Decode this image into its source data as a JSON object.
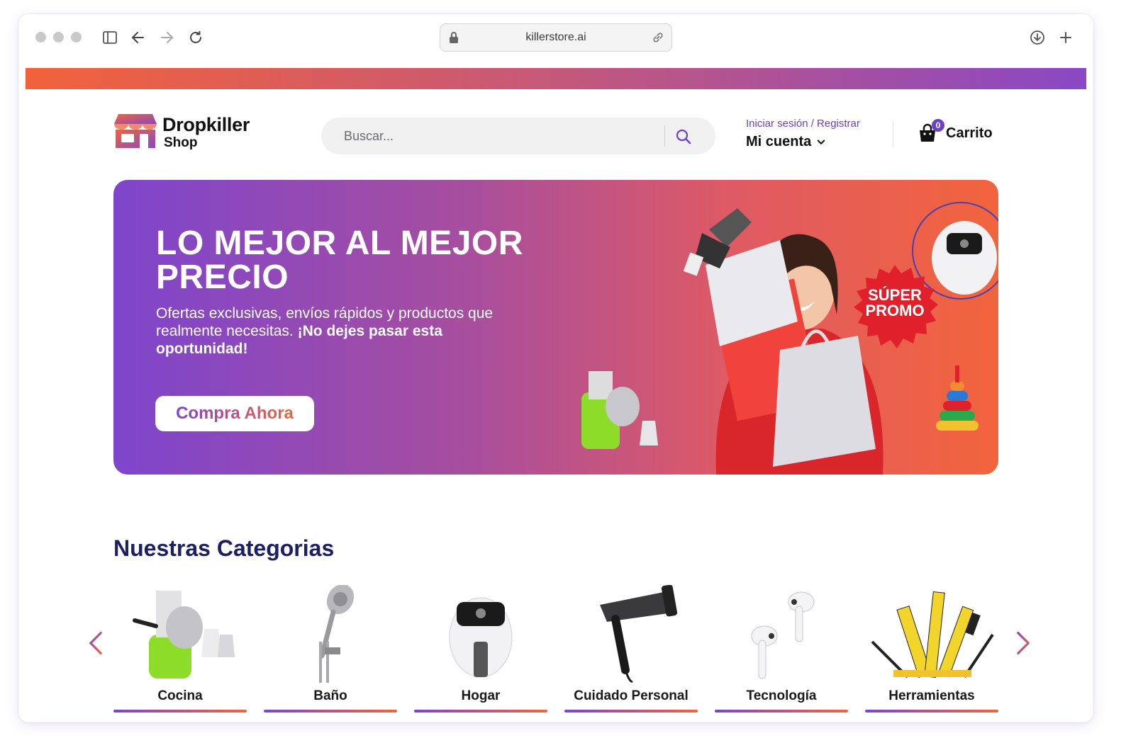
{
  "browser": {
    "url": "killerstore.ai"
  },
  "header": {
    "brand": "Dropkiller",
    "brand_sub": "Shop",
    "search_placeholder": "Buscar...",
    "login_label": "Iniciar sesión / Registrar",
    "account_label": "Mi cuenta",
    "cart_label": "Carrito",
    "cart_count": "0"
  },
  "hero": {
    "title": "LO MEJOR AL MEJOR PRECIO",
    "description": "Ofertas exclusivas, envíos rápidos y productos que realmente necesitas.",
    "description_bold": "¡No dejes pasar esta oportunidad!",
    "cta": "Compra Ahora",
    "badge_line1": "SÚPER",
    "badge_line2": "PROMO"
  },
  "categories": {
    "title": "Nuestras Categorias",
    "items": [
      {
        "label": "Cocina",
        "icon": "grater-icon"
      },
      {
        "label": "Baño",
        "icon": "shower-head-icon"
      },
      {
        "label": "Hogar",
        "icon": "air-fryer-icon"
      },
      {
        "label": "Cuidado Personal",
        "icon": "hair-dryer-icon"
      },
      {
        "label": "Tecnología",
        "icon": "earbuds-icon"
      },
      {
        "label": "Herramientas",
        "icon": "tools-icon"
      }
    ]
  },
  "colors": {
    "accent_purple": "#7e45cc",
    "accent_orange": "#f2643c",
    "heading_navy": "#1c2060",
    "promo_red": "#e0202a"
  }
}
